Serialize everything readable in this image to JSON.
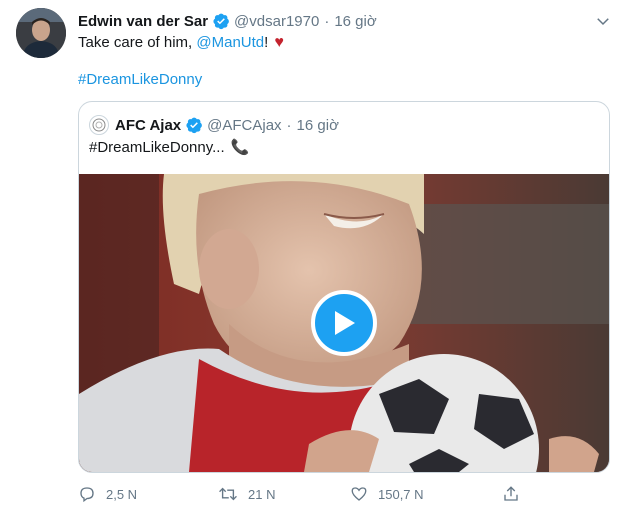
{
  "author": {
    "name": "Edwin van der Sar",
    "handle": "@vdsar1970",
    "time": "16 giờ"
  },
  "tweet": {
    "text_before": "Take care of him,",
    "mention": "@ManUtd",
    "text_after": "!",
    "hashtag": "#DreamLikeDonny"
  },
  "quoted": {
    "name": "AFC Ajax",
    "handle": "@AFCAjax",
    "time": "16 giờ",
    "text": "#DreamLikeDonny..."
  },
  "actions": {
    "replies": "2,5 N",
    "retweets": "21 N",
    "likes": "150,7 N"
  },
  "colors": {
    "accent": "#1da1f2",
    "link": "#1b95e0",
    "heart": "#c4232e",
    "muted": "#657786"
  }
}
